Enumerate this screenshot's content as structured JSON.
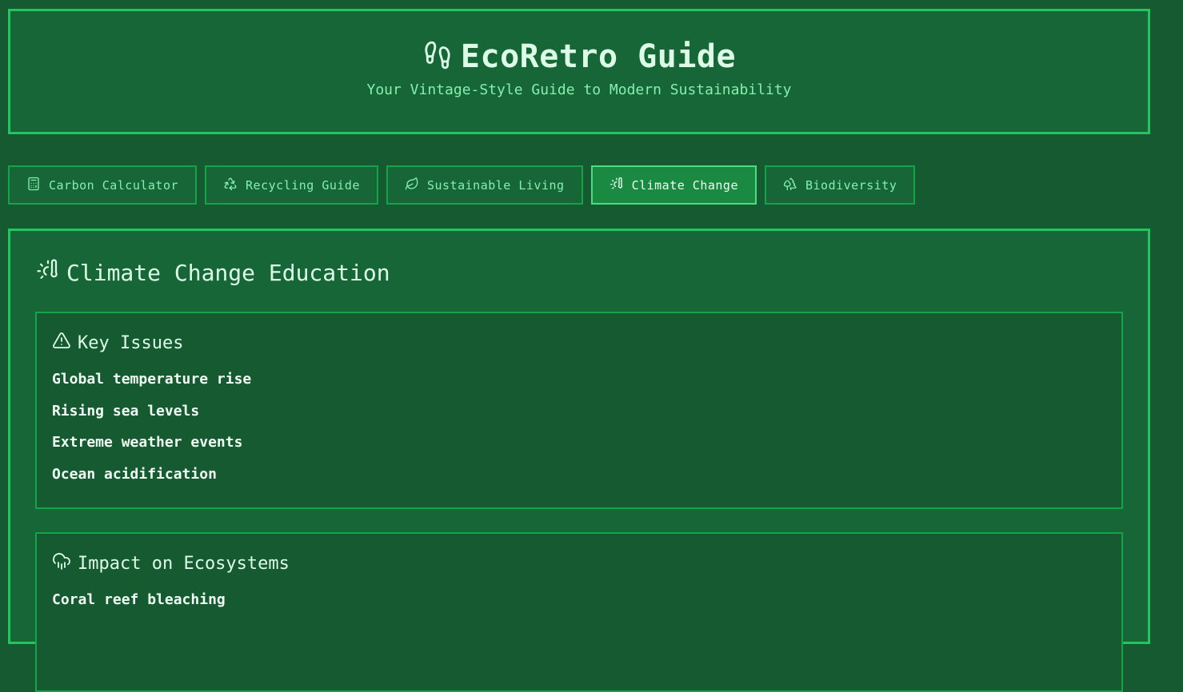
{
  "header": {
    "title": "EcoRetro Guide",
    "subtitle": "Your Vintage-Style Guide to Modern Sustainability",
    "logo_icon": "footprints-icon"
  },
  "tabs": [
    {
      "label": "Carbon Calculator",
      "icon": "calculator-icon",
      "active": false
    },
    {
      "label": "Recycling Guide",
      "icon": "recycle-icon",
      "active": false
    },
    {
      "label": "Sustainable Living",
      "icon": "leaf-icon",
      "active": false
    },
    {
      "label": "Climate Change",
      "icon": "thermometer-sun-icon",
      "active": true
    },
    {
      "label": "Biodiversity",
      "icon": "trees-icon",
      "active": false
    }
  ],
  "main": {
    "title": "Climate Change Education",
    "cards": [
      {
        "title": "Key Issues",
        "icon": "warning-icon",
        "items": [
          "Global temperature rise",
          "Rising sea levels",
          "Extreme weather events",
          "Ocean acidification"
        ]
      },
      {
        "title": "Impact on Ecosystems",
        "icon": "cloud-rain-icon",
        "items": [
          "Coral reef bleaching"
        ]
      }
    ]
  },
  "colors": {
    "background": "#165a31",
    "panel": "#166637",
    "border": "#22c55e",
    "accent_text": "#86efac"
  }
}
